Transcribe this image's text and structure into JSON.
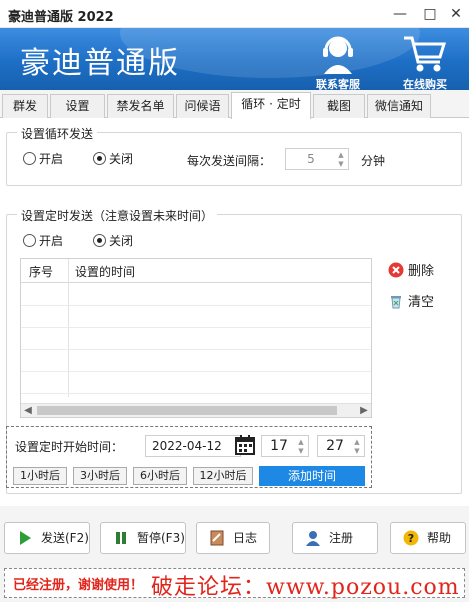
{
  "window": {
    "title": "豪迪普通版 2022",
    "minimize_glyph": "—",
    "maximize_glyph": "□",
    "close_glyph": "✕"
  },
  "banner": {
    "app_title": "豪迪普通版",
    "service_label": "联系客服",
    "cart_label": "在线购买",
    "service_icon": "headset-icon",
    "cart_icon": "cart-icon"
  },
  "tabs": [
    {
      "label": "群发"
    },
    {
      "label": "设置"
    },
    {
      "label": "禁发名单"
    },
    {
      "label": "问候语"
    },
    {
      "label": "循环 · 定时",
      "active": true
    },
    {
      "label": "截图"
    },
    {
      "label": "微信通知"
    }
  ],
  "loop": {
    "group_title": "设置循环发送",
    "on_label": "开启",
    "off_label": "关闭",
    "selected": "off",
    "interval_label": "每次发送间隔：",
    "interval_value": "5",
    "unit_label": "分钟"
  },
  "timer": {
    "group_title": "设置定时发送（注意设置未来时间）",
    "on_label": "开启",
    "off_label": "关闭",
    "selected": "off",
    "table": {
      "columns": [
        "序号",
        "设置的时间"
      ],
      "rows": []
    },
    "delete_label": "删除",
    "clear_label": "清空",
    "start_label": "设置定时开始时间：",
    "date_value": "2022-04-12",
    "hour_value": "17",
    "minute_value": "27",
    "quick_buttons": [
      "1小时后",
      "3小时后",
      "6小时后",
      "12小时后"
    ],
    "add_label": "添加时间"
  },
  "bottom": {
    "send_label": "发送(F2)",
    "pause_label": "暂停(F3)",
    "log_label": "日志",
    "register_label": "注册",
    "help_label": "帮助"
  },
  "status": {
    "message": "已经注册，谢谢使用！",
    "watermark": "破走论坛：www.pozou.com"
  },
  "colors": {
    "banner_blue": "#1d6fc6",
    "accent_blue": "#1e88e5",
    "status_red": "#e1251b"
  }
}
